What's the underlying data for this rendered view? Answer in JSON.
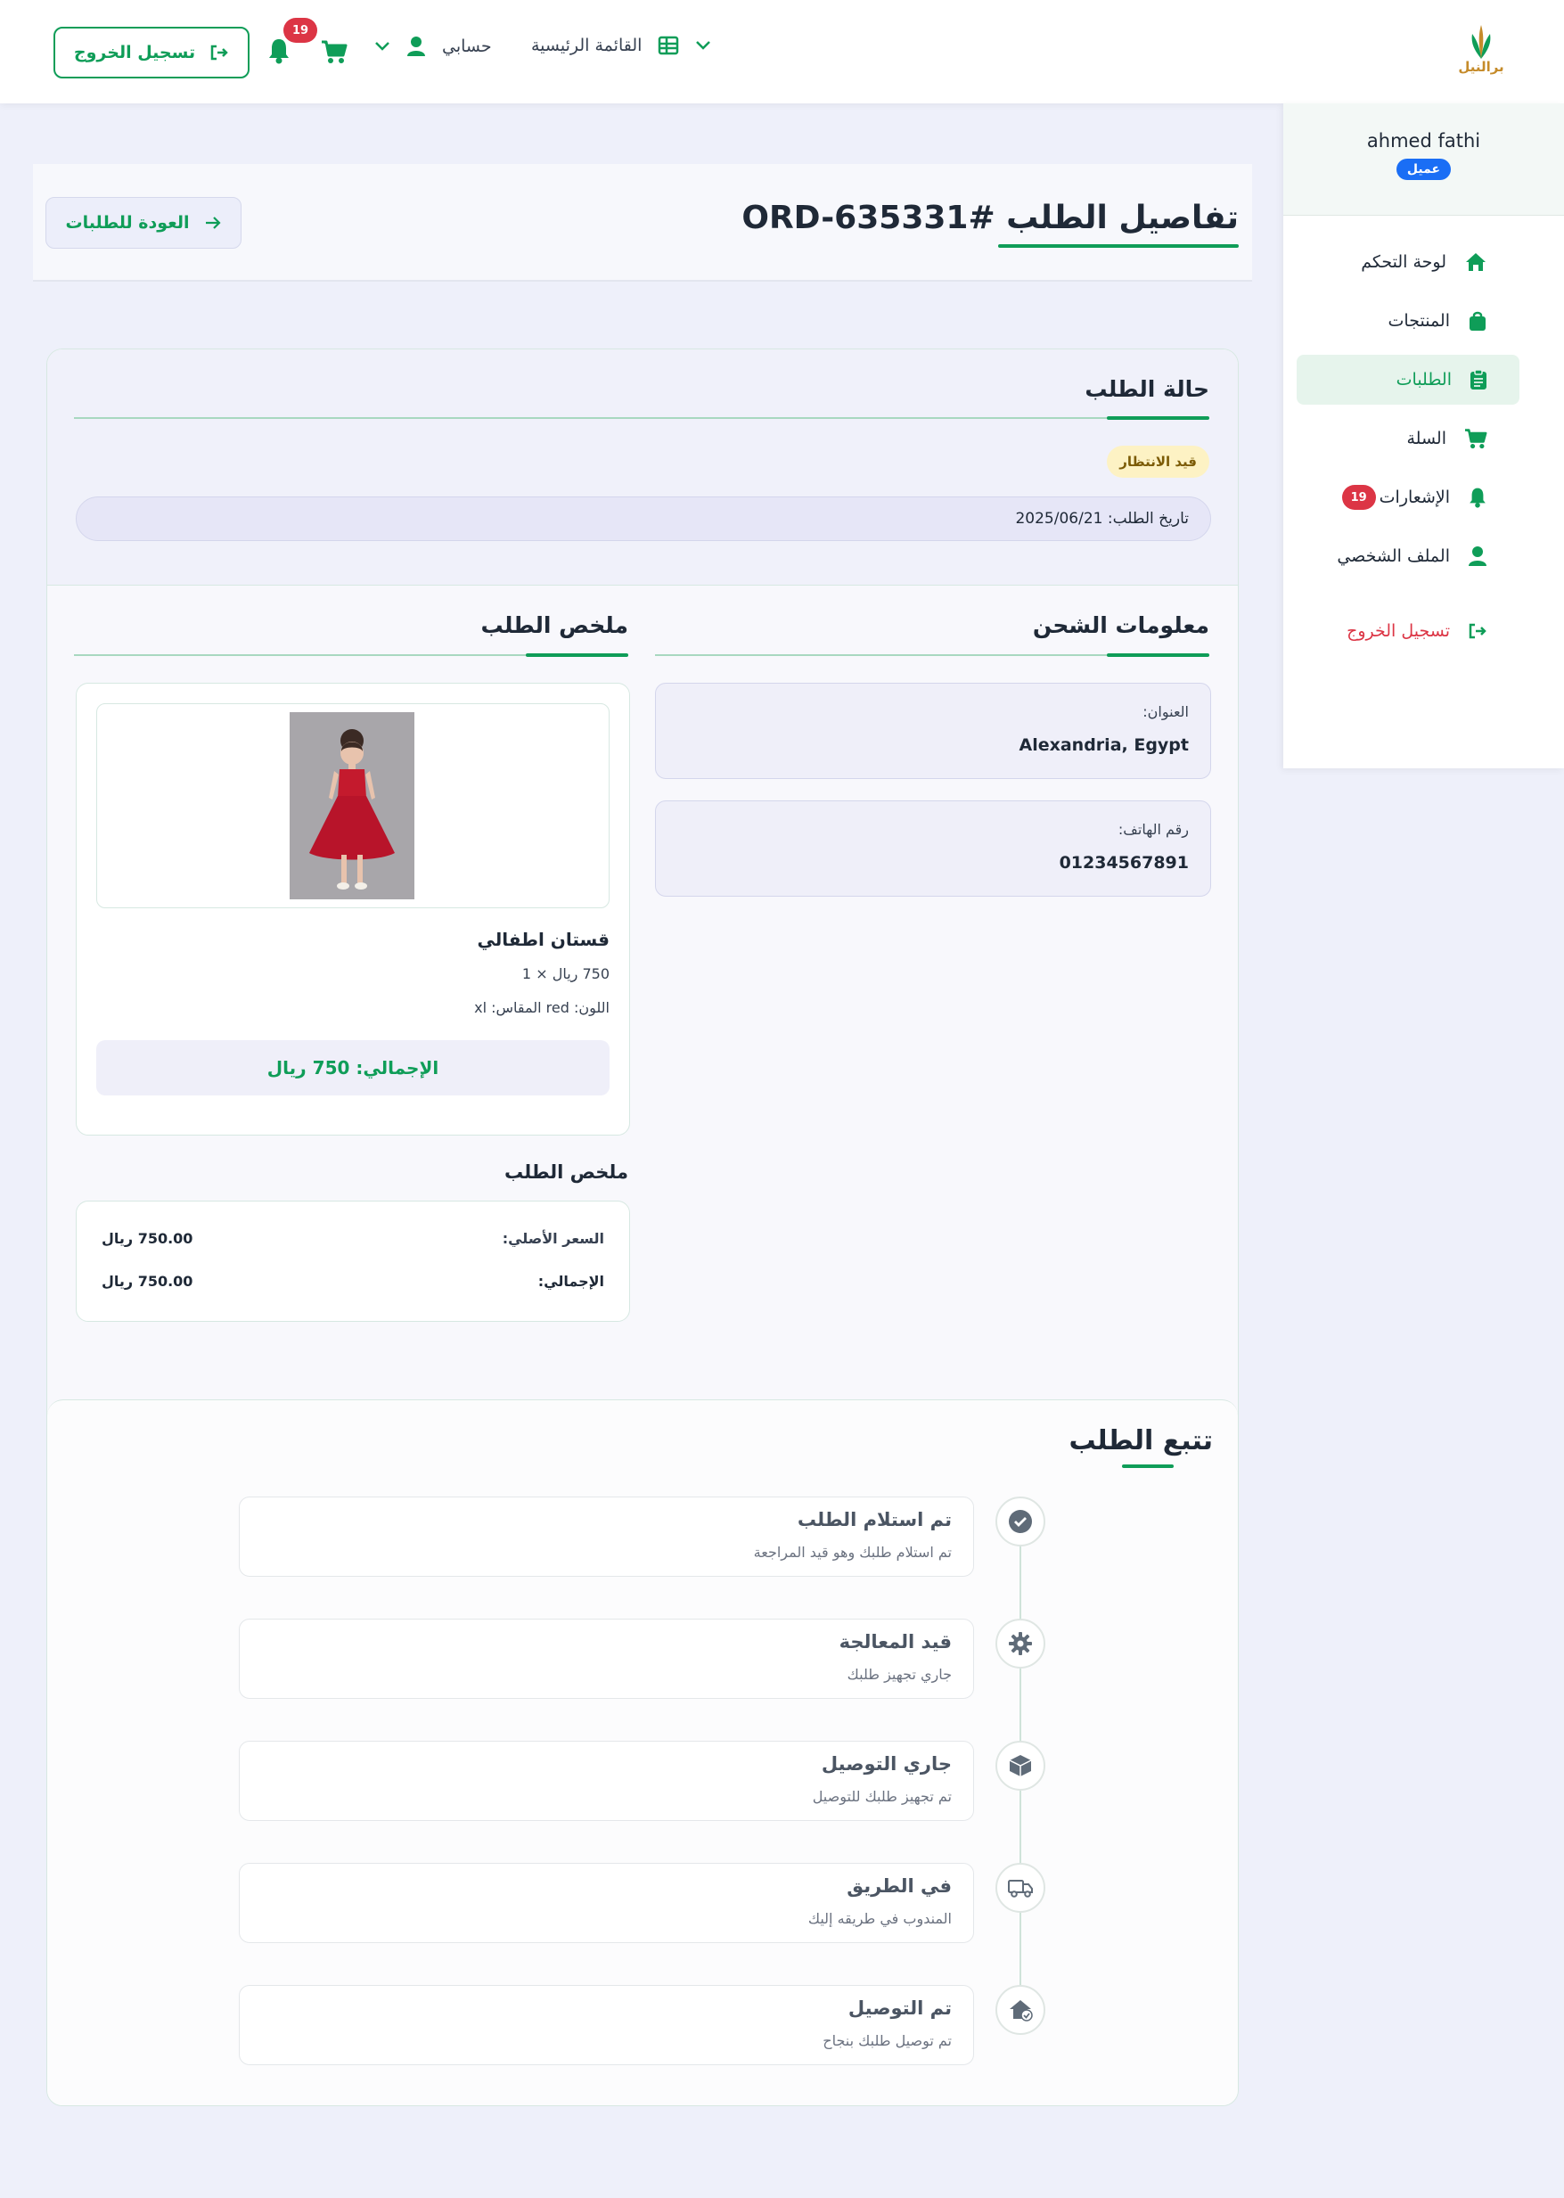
{
  "header": {
    "logo_text": "برالنيل",
    "logout_label": "تسجيل الخروج",
    "notifications_count": "19",
    "account_label": "حسابي",
    "main_menu_label": "القائمة الرئيسية"
  },
  "sidebar": {
    "user_name": "ahmed fathi",
    "user_role": "عميل",
    "items": [
      {
        "label": "لوحة التحكم",
        "icon": "home-icon"
      },
      {
        "label": "المنتجات",
        "icon": "bag-icon"
      },
      {
        "label": "الطلبات",
        "icon": "clipboard-icon",
        "active": true
      },
      {
        "label": "السلة",
        "icon": "cart-icon"
      },
      {
        "label": "الإشعارات",
        "icon": "bell-icon",
        "badge": "19"
      },
      {
        "label": "الملف الشخصي",
        "icon": "user-icon"
      }
    ],
    "logout_label": "تسجيل الخروج"
  },
  "page": {
    "title": "تفاصيل الطلب #ORD-635331",
    "back_label": "العودة للطلبات"
  },
  "status": {
    "title": "حالة الطلب",
    "badge": "قيد الانتظار",
    "date": "تاريخ الطلب: 2025/06/21"
  },
  "shipping": {
    "title": "معلومات الشحن",
    "address_label": "العنوان:",
    "address_value": "Alexandria, Egypt",
    "phone_label": "رقم الهاتف:",
    "phone_value": "01234567891"
  },
  "order_summary": {
    "title": "ملخص الطلب",
    "product_name": "قستان اطفالي",
    "price_line": "750 ريال × 1",
    "variant_line": "اللون: red المقاس: xl",
    "total_line": "الإجمالي: 750 ريال",
    "summary_title": "ملخص الطلب",
    "original_price_label": "السعر الأصلي:",
    "original_price_value": "750.00 ريال",
    "total_label": "الإجمالي:",
    "total_value": "750.00 ريال"
  },
  "tracking": {
    "title": "تتبع الطلب",
    "steps": [
      {
        "title": "تم استلام الطلب",
        "desc": "تم استلام طلبك وهو قيد المراجعة",
        "icon": "check-circle-icon"
      },
      {
        "title": "قيد المعالجة",
        "desc": "جاري تجهيز طلبك",
        "icon": "gear-icon"
      },
      {
        "title": "جاري التوصيل",
        "desc": "تم تجهيز طلبك للتوصيل",
        "icon": "box-icon"
      },
      {
        "title": "في الطريق",
        "desc": "المندوب في طريقه إليك",
        "icon": "truck-icon"
      },
      {
        "title": "تم التوصيل",
        "desc": "تم توصيل طلبك بنجاح",
        "icon": "home-check-icon"
      }
    ]
  },
  "colors": {
    "accent": "#0f9d58",
    "danger": "#dc3545",
    "role_badge": "#1a6ef5",
    "status_badge": "#fdf2c4"
  }
}
